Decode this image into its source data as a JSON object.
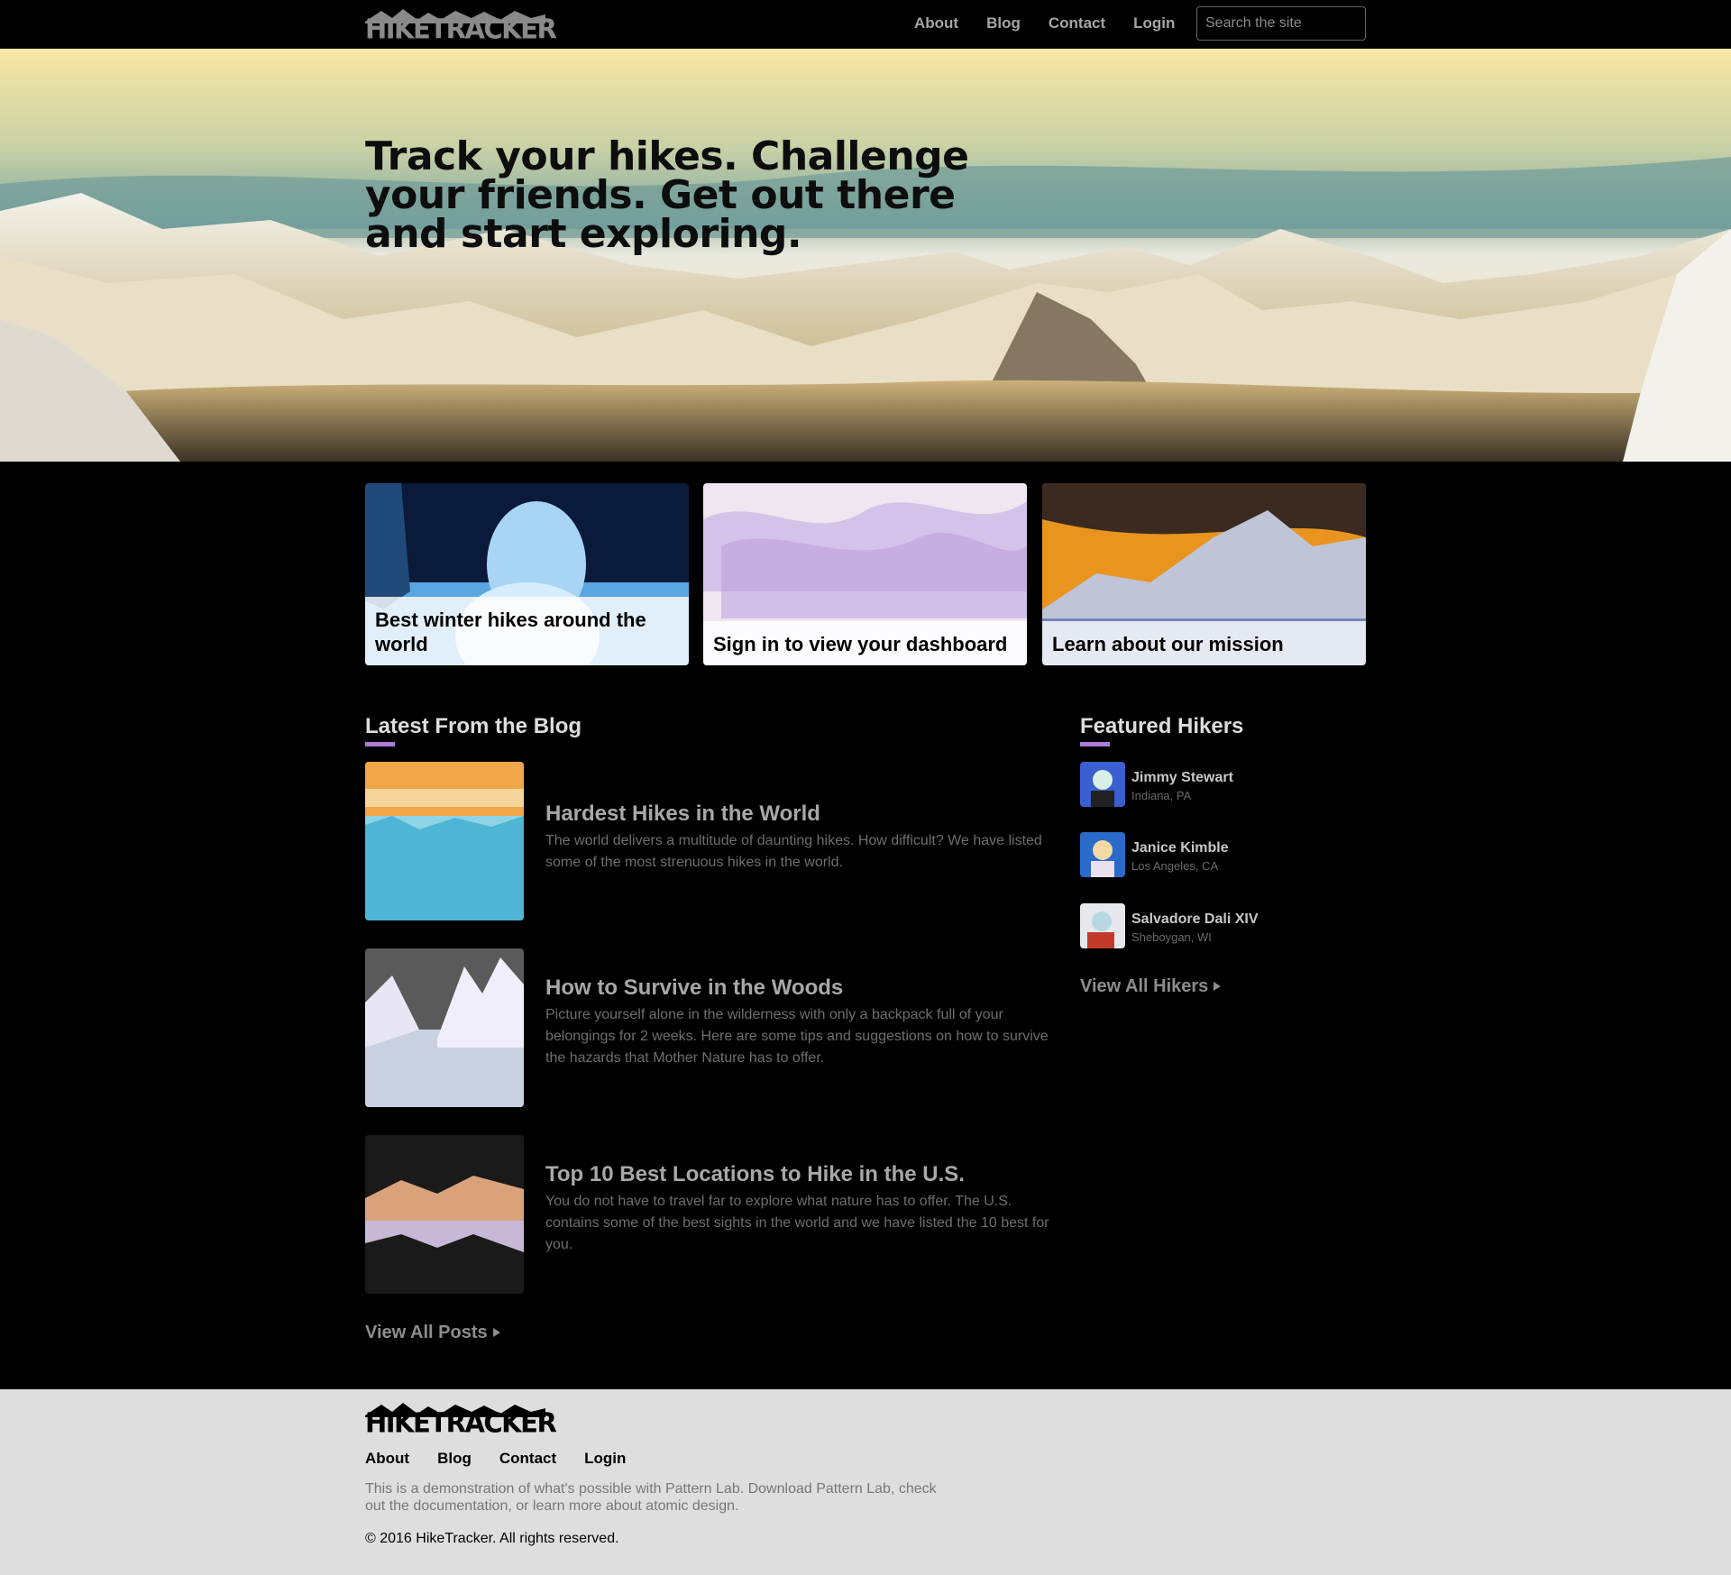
{
  "header": {
    "logo_text": "HIKETRACKER",
    "nav": [
      "About",
      "Blog",
      "Contact",
      "Login"
    ],
    "search_placeholder": "Search the site"
  },
  "hero": {
    "title": "Track your hikes. Challenge your friends. Get out there and start exploring."
  },
  "cards": [
    {
      "label": "Best winter hikes around the world"
    },
    {
      "label": "Sign in to view your dashboard"
    },
    {
      "label": "Learn about our mission"
    }
  ],
  "blog": {
    "heading": "Latest From the Blog",
    "posts": [
      {
        "title": "Hardest Hikes in the World",
        "description": "The world delivers a multitude of daunting hikes. How difficult? We have listed some of the most strenuous hikes in the world."
      },
      {
        "title": "How to Survive in the Woods",
        "description": "Picture yourself alone in the wilderness with only a backpack full of your belongings for 2 weeks. Here are some tips and suggestions on how to survive the hazards that Mother Nature has to offer."
      },
      {
        "title": "Top 10 Best Locations to Hike in the U.S.",
        "description": "You do not have to travel far to explore what nature has to offer. The U.S. contains some of the best sights in the world and we have listed the 10 best for you."
      }
    ],
    "view_all": "View All Posts"
  },
  "hikers": {
    "heading": "Featured Hikers",
    "items": [
      {
        "name": "Jimmy Stewart",
        "location": "Indiana, PA"
      },
      {
        "name": "Janice Kimble",
        "location": "Los Angeles, CA"
      },
      {
        "name": "Salvadore Dali XIV",
        "location": "Sheboygan, WI"
      }
    ],
    "view_all": "View All Hikers"
  },
  "footer": {
    "logo_text": "HIKETRACKER",
    "nav": [
      "About",
      "Blog",
      "Contact",
      "Login"
    ],
    "description": "This is a demonstration of what's possible with Pattern Lab. Download Pattern Lab, check out the documentation, or learn more about atomic design.",
    "copyright": "© 2016 HikeTracker. All rights reserved."
  },
  "colors": {
    "accent": "#a97cd8",
    "header_bg": "#000000",
    "footer_bg": "#dedede"
  }
}
